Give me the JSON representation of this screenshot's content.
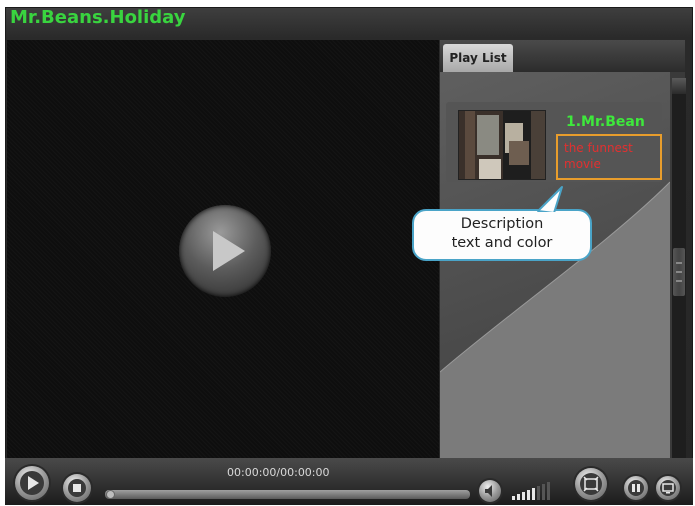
{
  "window": {
    "title": "Mr.Beans.Holiday"
  },
  "playlist": {
    "tab_label": "Play List",
    "items": [
      {
        "title": "1.Mr.Bean",
        "description": "the funnest movie"
      }
    ]
  },
  "annotation": {
    "callout_line1": "Description",
    "callout_line2": "text and color"
  },
  "controls": {
    "time": "00:00:00/00:00:00"
  },
  "colors": {
    "title_green": "#39d43f",
    "item_title_green": "#3ee83c",
    "description_red": "#e23030",
    "highlight_orange": "#e89d2c",
    "callout_border_blue": "#4aa4c8"
  }
}
